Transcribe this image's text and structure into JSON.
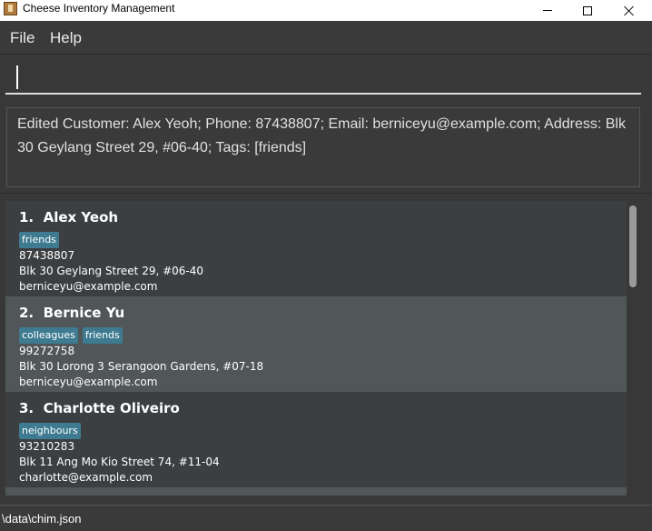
{
  "window": {
    "title": "Cheese Inventory Management",
    "icon": "cheese-app-icon"
  },
  "menu": {
    "items": [
      {
        "label": "File"
      },
      {
        "label": "Help"
      }
    ]
  },
  "command": {
    "value": "",
    "placeholder": ""
  },
  "result": {
    "text": "Edited Customer: Alex Yeoh; Phone: 87438807; Email: berniceyu@example.com; Address: Blk 30 Geylang Street 29, #06-40; Tags: [friends]"
  },
  "customers": [
    {
      "index": "1.",
      "name": "Alex Yeoh",
      "tags": [
        "friends"
      ],
      "phone": "87438807",
      "address": "Blk 30 Geylang Street 29, #06-40",
      "email": "berniceyu@example.com"
    },
    {
      "index": "2.",
      "name": "Bernice Yu",
      "tags": [
        "colleagues",
        "friends"
      ],
      "phone": "99272758",
      "address": "Blk 30 Lorong 3 Serangoon Gardens, #07-18",
      "email": "berniceyu@example.com"
    },
    {
      "index": "3.",
      "name": "Charlotte Oliveiro",
      "tags": [
        "neighbours"
      ],
      "phone": "93210283",
      "address": "Blk 11 Ang Mo Kio Street 74, #11-04",
      "email": "charlotte@example.com"
    }
  ],
  "status": {
    "path": "\\data\\chim.json"
  },
  "colors": {
    "background": "#383838",
    "card_odd": "#3c3f41",
    "card_even": "#515658",
    "tag": "#3e7b91"
  }
}
